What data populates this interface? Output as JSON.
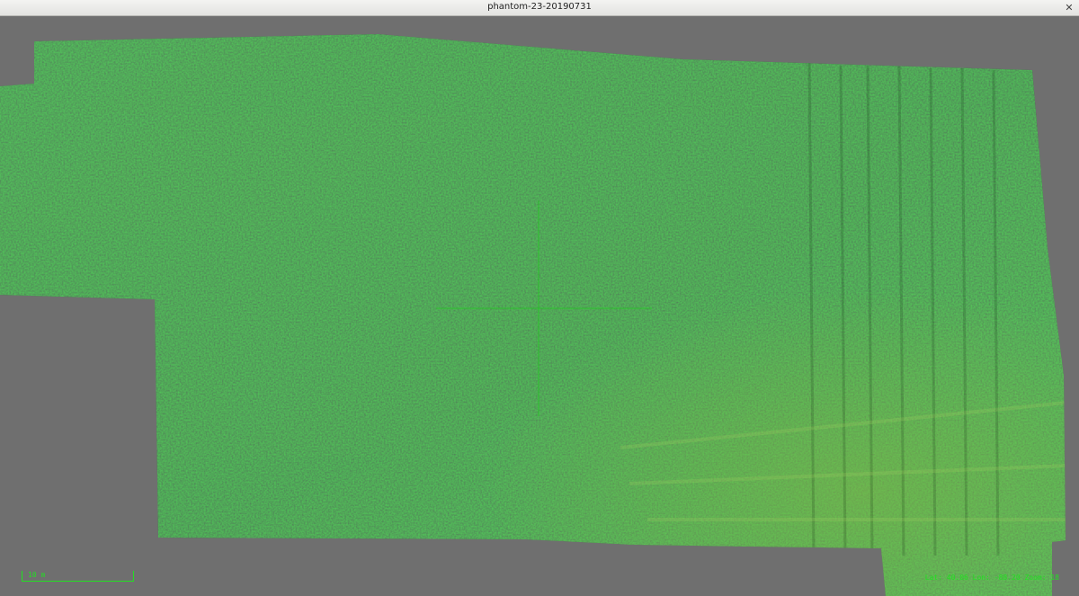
{
  "window": {
    "title": "phantom-23-20190731"
  },
  "controls": {
    "close_glyph": "✕"
  },
  "overlay": {
    "scale_label": "10 m",
    "coordinates": "Lat: 40.06 Lon: -88.20 Zoom: 18"
  },
  "colors": {
    "background": "#6f6f6f",
    "overlay_green": "#22e022",
    "crop_dark": "#1f4a22",
    "crop_light": "#5a9a3a"
  },
  "icons": {
    "crosshair": "crosshair-icon",
    "close": "close-icon"
  }
}
